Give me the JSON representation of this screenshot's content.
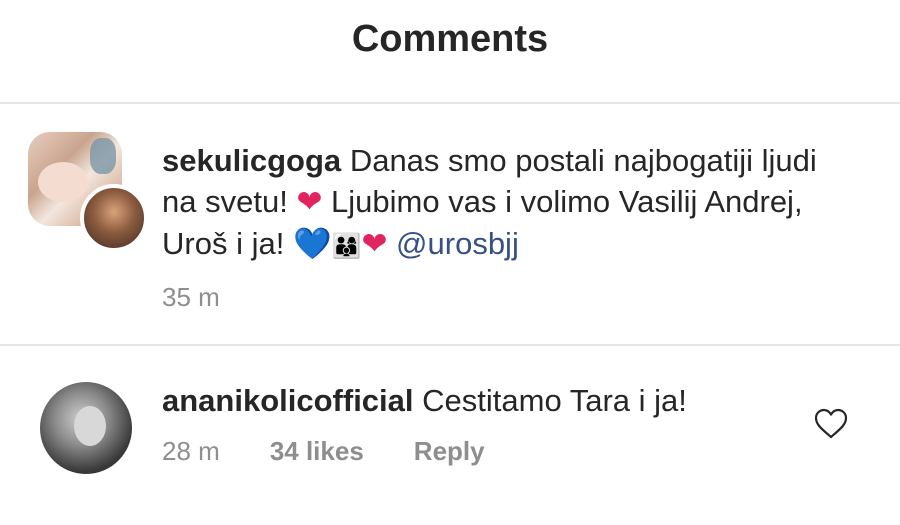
{
  "header": {
    "title": "Comments"
  },
  "caption": {
    "username": "sekulicgoga",
    "text_part1": "Danas smo postali najbogatiji ljudi na svetu!",
    "text_part2": "Ljubimo vas i volimo Vasilij Andrej, Uroš i ja!",
    "emoji_heart": "❤",
    "emoji_blue_heart": "💙",
    "emoji_family": "👨‍👩‍👦",
    "mention": "@urosbjj",
    "time": "35 m"
  },
  "comment": {
    "username": "ananikolicofficial",
    "text": "Cestitamo Tara i ja!",
    "time": "28 m",
    "likes": "34 likes",
    "reply_label": "Reply",
    "like_icon": "heart-outline-icon"
  },
  "colors": {
    "text": "#262626",
    "meta": "#8e8e8e",
    "mention": "#385185",
    "divider": "#e6e6e6"
  }
}
